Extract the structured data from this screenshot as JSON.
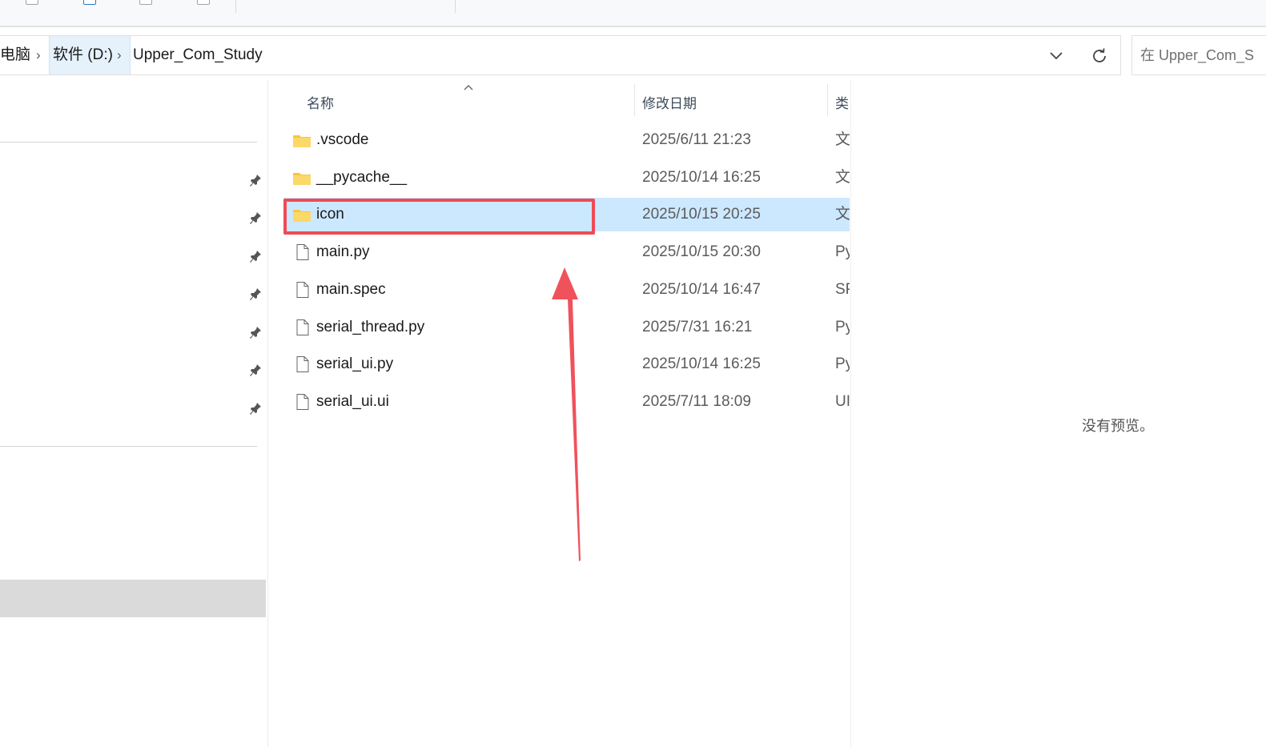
{
  "breadcrumb": {
    "items": [
      "电脑",
      "软件 (D:)",
      "Upper_Com_Study"
    ],
    "separator": "›"
  },
  "search": {
    "placeholder": "在 Upper_Com_S"
  },
  "toolbar": {
    "partial_text_1": "...",
    "partial_text_2": "..."
  },
  "columns": {
    "name": "名称",
    "date_modified": "修改日期",
    "type": "类"
  },
  "files": [
    {
      "name": ".vscode",
      "date": "2025/6/11 21:23",
      "type": "文",
      "icon": "folder-icon",
      "selected": false
    },
    {
      "name": "__pycache__",
      "date": "2025/10/14 16:25",
      "type": "文",
      "icon": "folder-icon",
      "selected": false
    },
    {
      "name": "icon",
      "date": "2025/10/15 20:25",
      "type": "文",
      "icon": "folder-icon",
      "selected": true
    },
    {
      "name": "main.py",
      "date": "2025/10/15 20:30",
      "type": "Py",
      "icon": "file-icon",
      "selected": false
    },
    {
      "name": "main.spec",
      "date": "2025/10/14 16:47",
      "type": "SP",
      "icon": "file-icon",
      "selected": false
    },
    {
      "name": "serial_thread.py",
      "date": "2025/7/31 16:21",
      "type": "Py",
      "icon": "file-icon",
      "selected": false
    },
    {
      "name": "serial_ui.py",
      "date": "2025/10/14 16:25",
      "type": "Py",
      "icon": "file-icon",
      "selected": false
    },
    {
      "name": "serial_ui.ui",
      "date": "2025/7/11 18:09",
      "type": "UI",
      "icon": "file-icon",
      "selected": false
    }
  ],
  "preview": {
    "message": "没有预览。"
  },
  "annotation_colors": {
    "highlight_box": "#ef4b55",
    "arrow": "#f0525b",
    "selected_row": "#cce8ff",
    "folder": "#f8c63c"
  }
}
